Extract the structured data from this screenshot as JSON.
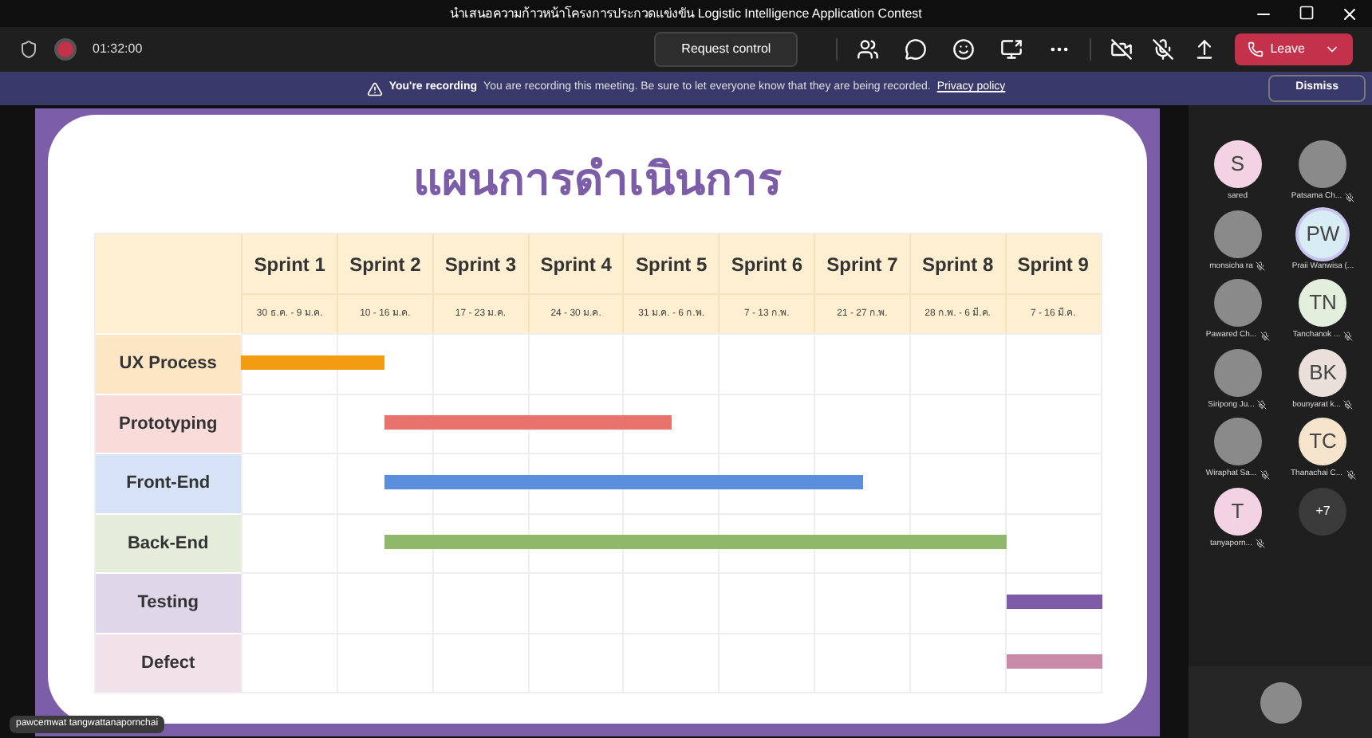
{
  "window": {
    "title": "นำเสนอความก้าวหน้าโครงการประกวดแข่งขัน Logistic Intelligence Application Contest"
  },
  "toolbar": {
    "timer": "01:32:00",
    "request_control": "Request control",
    "leave": "Leave"
  },
  "banner": {
    "title": "You're recording",
    "message": "You are recording this meeting. Be sure to let everyone know that they are being recorded.",
    "link": "Privacy policy",
    "dismiss": "Dismiss"
  },
  "slide": {
    "title": "แผนการดำเนินการ",
    "sprints": [
      {
        "name": "Sprint 1",
        "dates": "30 ธ.ค. - 9 ม.ค."
      },
      {
        "name": "Sprint 2",
        "dates": "10 - 16 ม.ค."
      },
      {
        "name": "Sprint 3",
        "dates": "17 - 23 ม.ค."
      },
      {
        "name": "Sprint 4",
        "dates": "24 - 30 ม.ค."
      },
      {
        "name": "Sprint 5",
        "dates": "31 ม.ค. - 6 ก.พ."
      },
      {
        "name": "Sprint 6",
        "dates": "7 - 13 ก.พ."
      },
      {
        "name": "Sprint 7",
        "dates": "21 - 27 ก.พ."
      },
      {
        "name": "Sprint 8",
        "dates": "28 ก.พ. - 6 มี.ค."
      },
      {
        "name": "Sprint 9",
        "dates": "7 - 16 มี.ค."
      }
    ],
    "tasks": [
      {
        "label": "UX Process",
        "color": "#f39c12",
        "cells": [
          {
            "kind": "full"
          },
          {
            "kind": "end"
          },
          {
            "kind": "empty"
          },
          {
            "kind": "empty"
          },
          {
            "kind": "empty"
          },
          {
            "kind": "empty"
          },
          {
            "kind": "empty"
          },
          {
            "kind": "empty"
          },
          {
            "kind": "empty"
          }
        ]
      },
      {
        "label": "Prototyping",
        "color": "#e8736c",
        "cells": [
          {
            "kind": "empty"
          },
          {
            "kind": "start"
          },
          {
            "kind": "full"
          },
          {
            "kind": "full"
          },
          {
            "kind": "end"
          },
          {
            "kind": "empty"
          },
          {
            "kind": "empty"
          },
          {
            "kind": "empty"
          },
          {
            "kind": "empty"
          }
        ]
      },
      {
        "label": "Front-End",
        "color": "#5b8fdc",
        "cells": [
          {
            "kind": "empty"
          },
          {
            "kind": "start"
          },
          {
            "kind": "full"
          },
          {
            "kind": "full"
          },
          {
            "kind": "full"
          },
          {
            "kind": "full"
          },
          {
            "kind": "end"
          },
          {
            "kind": "empty"
          },
          {
            "kind": "empty"
          }
        ]
      },
      {
        "label": "Back-End",
        "color": "#8fb86b",
        "cells": [
          {
            "kind": "empty"
          },
          {
            "kind": "start"
          },
          {
            "kind": "full"
          },
          {
            "kind": "full"
          },
          {
            "kind": "full"
          },
          {
            "kind": "full"
          },
          {
            "kind": "full"
          },
          {
            "kind": "full"
          },
          {
            "kind": "empty"
          }
        ]
      },
      {
        "label": "Testing",
        "color": "#7d5ba6",
        "cells": [
          {
            "kind": "empty"
          },
          {
            "kind": "empty"
          },
          {
            "kind": "empty"
          },
          {
            "kind": "empty"
          },
          {
            "kind": "empty"
          },
          {
            "kind": "empty"
          },
          {
            "kind": "empty"
          },
          {
            "kind": "empty"
          },
          {
            "kind": "full"
          }
        ]
      },
      {
        "label": "Defect",
        "color": "#c98aa8",
        "cells": [
          {
            "kind": "empty"
          },
          {
            "kind": "empty"
          },
          {
            "kind": "empty"
          },
          {
            "kind": "empty"
          },
          {
            "kind": "empty"
          },
          {
            "kind": "empty"
          },
          {
            "kind": "empty"
          },
          {
            "kind": "empty"
          },
          {
            "kind": "full"
          }
        ]
      }
    ]
  },
  "participants": [
    {
      "kind": "initials",
      "initials": "S",
      "name": "sared",
      "color": "#f3d3e3",
      "muted": false,
      "speaking": false
    },
    {
      "kind": "photo",
      "name": "Patsama Ch...",
      "muted": true,
      "speaking": false
    },
    {
      "kind": "photo",
      "name": "monsicha ra",
      "muted": true,
      "speaking": false
    },
    {
      "kind": "initials",
      "initials": "PW",
      "name": "Praii Wanwisa (...",
      "color": "#d7ecf3",
      "muted": false,
      "speaking": true
    },
    {
      "kind": "photo",
      "name": "Pawared Ch...",
      "muted": true,
      "speaking": false
    },
    {
      "kind": "initials",
      "initials": "TN",
      "name": "Tanchanok ...",
      "color": "#e3efdc",
      "muted": true,
      "speaking": false
    },
    {
      "kind": "photo",
      "name": "Siripong Ju...",
      "muted": true,
      "speaking": false
    },
    {
      "kind": "initials",
      "initials": "BK",
      "name": "bounyarat k...",
      "color": "#eadfda",
      "muted": true,
      "speaking": false
    },
    {
      "kind": "photo",
      "name": "Wiraphat Sa...",
      "muted": true,
      "speaking": false
    },
    {
      "kind": "initials",
      "initials": "TC",
      "name": "Thanachai C...",
      "color": "#f6e3cc",
      "muted": true,
      "speaking": false
    },
    {
      "kind": "initials",
      "initials": "T",
      "name": "tanyaporn...",
      "color": "#f3d3e3",
      "muted": true,
      "speaking": false
    },
    {
      "kind": "overflow",
      "initials": "+7"
    }
  ],
  "presenter": {
    "name": "pawcemwat tangwattanapornchai"
  }
}
